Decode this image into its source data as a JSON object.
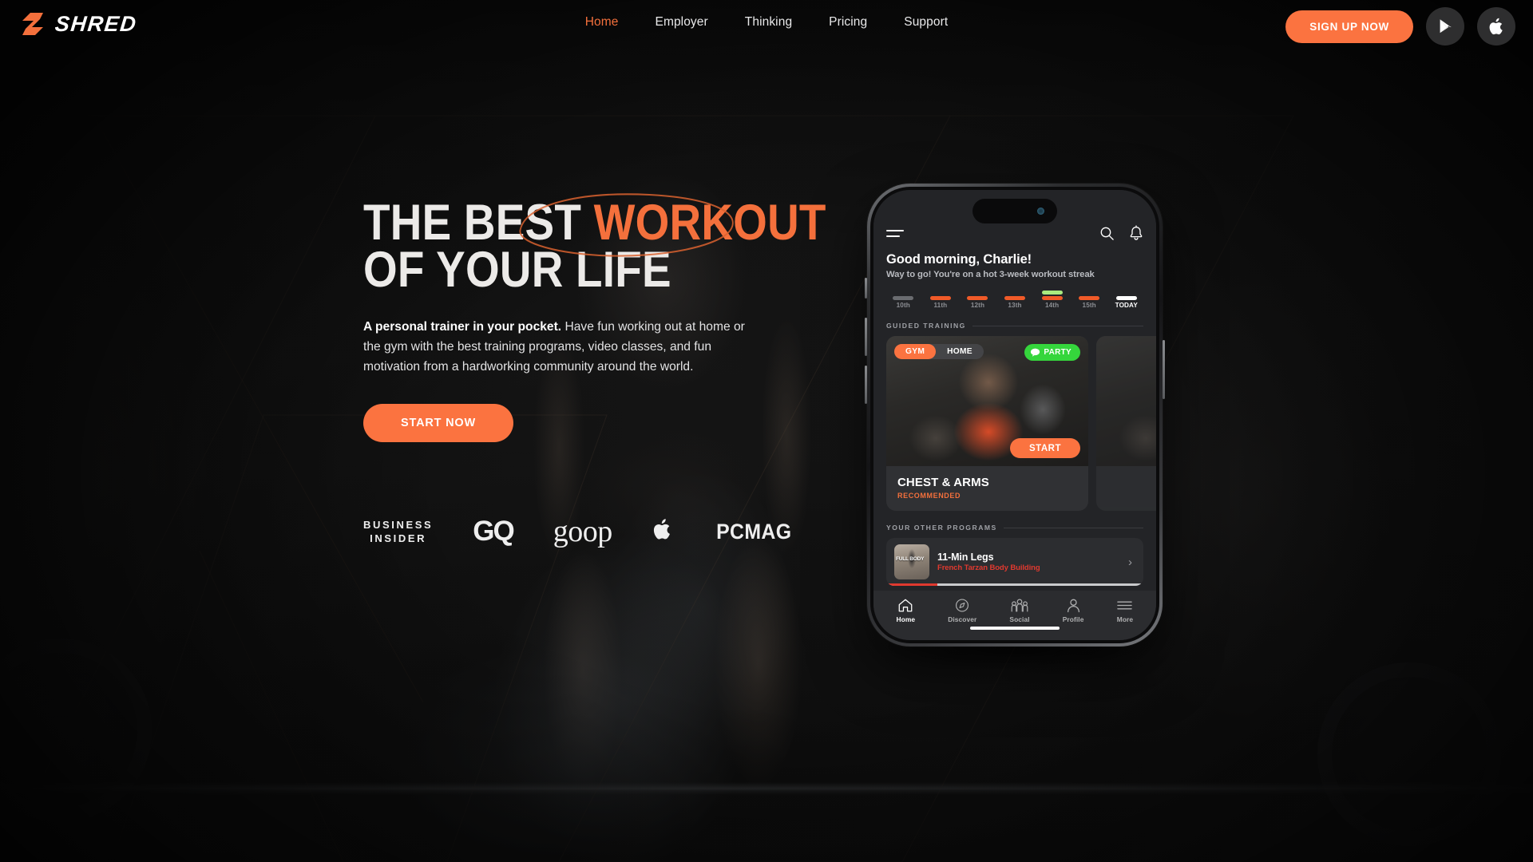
{
  "brand": {
    "name": "SHRED",
    "logo_icon": "shred-s-logo-icon",
    "accent": "#fb7340"
  },
  "nav": {
    "links": [
      {
        "label": "Home",
        "active": true
      },
      {
        "label": "Employer",
        "active": false
      },
      {
        "label": "Thinking",
        "active": false
      },
      {
        "label": "Pricing",
        "active": false
      },
      {
        "label": "Support",
        "active": false
      }
    ],
    "signup_label": "SIGN UP NOW",
    "store_buttons": [
      {
        "name": "google-play-icon",
        "label": "Google Play"
      },
      {
        "name": "apple-app-store-icon",
        "label": "App Store"
      }
    ]
  },
  "hero": {
    "headline_line1_plain": "THE BEST ",
    "headline_line1_highlight": "WORKOUT",
    "headline_line2": "OF YOUR LIFE",
    "lede_bold": "A personal trainer in your pocket.",
    "lede_rest": " Have fun working out at home or the gym with the best training programs, video classes, and fun motivation from a hardworking community around the world.",
    "cta_label": "START NOW",
    "press_logos": [
      {
        "name": "business-insider-logo",
        "line1": "BUSINESS",
        "line2": "INSIDER"
      },
      {
        "name": "gq-logo",
        "text": "GQ"
      },
      {
        "name": "goop-logo",
        "text": "goop"
      },
      {
        "name": "apple-logo",
        "text": ""
      },
      {
        "name": "pcmag-logo",
        "text": "PCMAG"
      }
    ]
  },
  "phone_app": {
    "topbar": {
      "menu_icon": "hamburger-menu-icon",
      "search_icon": "search-icon",
      "notification_icon": "bell-icon"
    },
    "greeting_title": "Good morning, Charlie!",
    "greeting_subtitle": "Way to go! You're on a hot 3-week workout streak",
    "daystrip": [
      {
        "label": "10th",
        "bars": [
          "#6a6c70"
        ]
      },
      {
        "label": "11th",
        "bars": [
          "#f05a28"
        ]
      },
      {
        "label": "12th",
        "bars": [
          "#f05a28"
        ]
      },
      {
        "label": "13th",
        "bars": [
          "#f05a28"
        ]
      },
      {
        "label": "14th",
        "bars": [
          "#a9ea7f",
          "#f05a28"
        ]
      },
      {
        "label": "15th",
        "bars": [
          "#f05a28"
        ]
      },
      {
        "label": "TODAY",
        "bars": [
          "#ffffff"
        ],
        "today": true
      }
    ],
    "guided_training": {
      "section_label": "GUIDED TRAINING",
      "card": {
        "chip_gym": "GYM",
        "chip_home": "HOME",
        "party_label": "PARTY",
        "party_icon": "chat-bubble-icon",
        "start_label": "START",
        "title": "CHEST & ARMS",
        "subtitle": "RECOMMENDED"
      }
    },
    "other_programs": {
      "section_label": "YOUR OTHER PROGRAMS",
      "items": [
        {
          "title": "11-Min Legs",
          "subtitle": "French Tarzan Body Building",
          "thumb_text": "FULL BODY",
          "progress_percent": 20,
          "chevron_icon": "chevron-right-icon"
        }
      ]
    },
    "tabbar": [
      {
        "label": "Home",
        "icon": "home-icon",
        "active": true
      },
      {
        "label": "Discover",
        "icon": "compass-icon",
        "active": false
      },
      {
        "label": "Social",
        "icon": "people-group-icon",
        "active": false
      },
      {
        "label": "Profile",
        "icon": "person-icon",
        "active": false
      },
      {
        "label": "More",
        "icon": "menu-lines-icon",
        "active": false
      }
    ]
  }
}
